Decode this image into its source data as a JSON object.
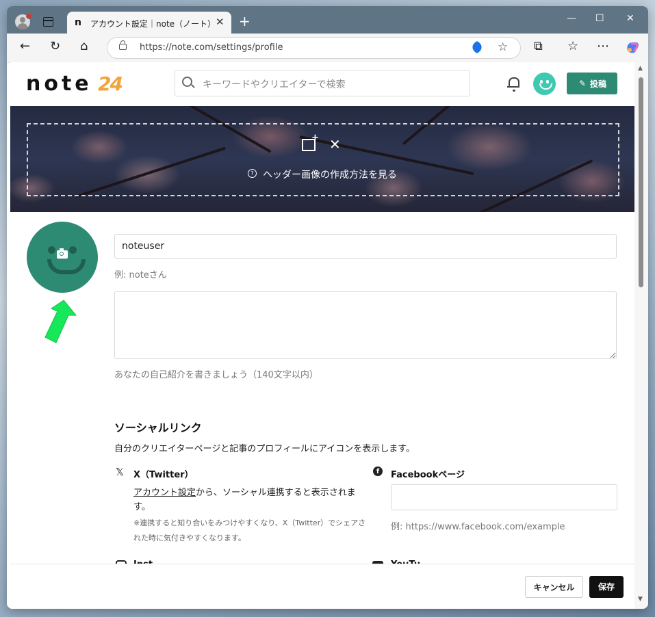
{
  "browser": {
    "tab_favicon": "n",
    "tab_title": "アカウント設定｜note（ノート）",
    "url": "https://note.com/settings/profile",
    "icons": [
      "profile-icon",
      "tabs-icon",
      "back-icon",
      "reload-icon",
      "home-icon",
      "lock-icon",
      "tag-icon",
      "star-icon",
      "extensions-icon",
      "favorites-icon",
      "more-icon",
      "copilot-icon"
    ]
  },
  "header": {
    "logo": "note",
    "logo_badge": "24",
    "search_placeholder": "キーワードやクリエイターで検索",
    "post_label": "投稿",
    "accent_color": "#2d8a73"
  },
  "cover": {
    "help_text": "ヘッダー画像の作成方法を見る"
  },
  "profile": {
    "name_value": "noteuser",
    "name_hint": "例: noteさん",
    "bio_value": "",
    "bio_hint": "あなたの自己紹介を書きましょう（140文字以内）"
  },
  "social": {
    "title": "ソーシャルリンク",
    "description": "自分のクリエイターページと記事のプロフィールにアイコンを表示します。",
    "x_label": "X（Twitter）",
    "x_link": "アカウント設定",
    "x_desc_rest": "から、ソーシャル連携すると表示されます。",
    "x_note": "※連携すると知り合いをみつけやすくなり、X（Twitter）でシェアされた時に気付きやすくなります。",
    "facebook_label": "Facebookページ",
    "facebook_value": "",
    "facebook_hint": "例: https://www.facebook.com/example",
    "clipped_left": "Inst",
    "clipped_right": "YouTu"
  },
  "footer": {
    "cancel_label": "キャンセル",
    "save_label": "保存"
  }
}
